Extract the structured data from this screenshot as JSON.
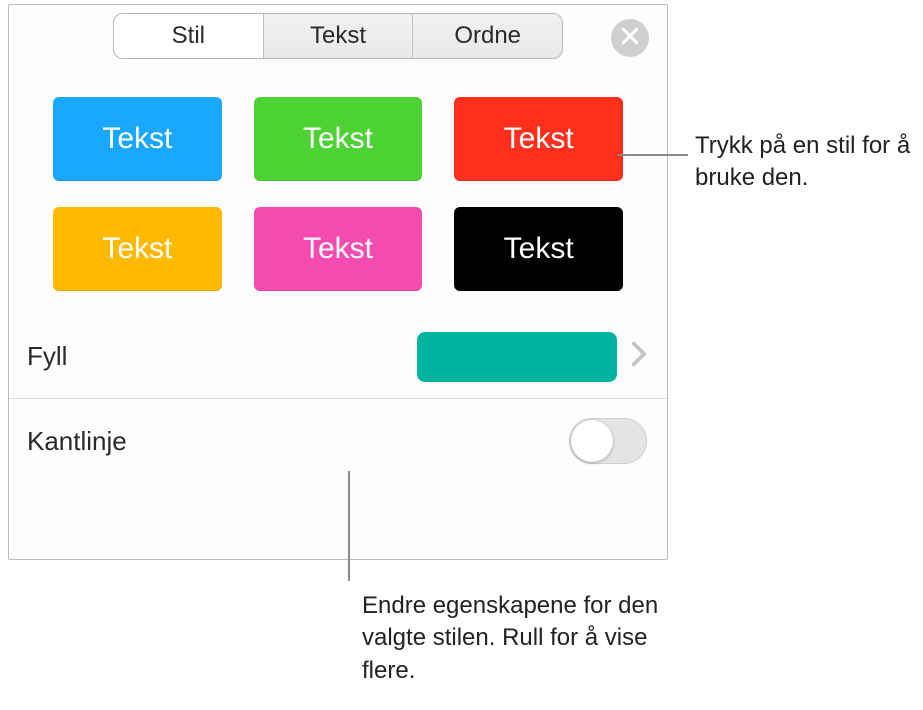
{
  "tabs": {
    "style": "Stil",
    "text": "Tekst",
    "arrange": "Ordne"
  },
  "swatches": [
    {
      "label": "Tekst",
      "bg": "#1aa7ff"
    },
    {
      "label": "Tekst",
      "bg": "#4cd233"
    },
    {
      "label": "Tekst",
      "bg": "#ff2f1e"
    },
    {
      "label": "Tekst",
      "bg": "#ffb901"
    },
    {
      "label": "Tekst",
      "bg": "#f54bb0"
    },
    {
      "label": "Tekst",
      "bg": "#000000"
    }
  ],
  "fill": {
    "label": "Fyll",
    "color": "#00b5a0"
  },
  "border": {
    "label": "Kantlinje"
  },
  "callouts": {
    "tapStyle": "Trykk på en stil for å bruke den.",
    "changeProps": "Endre egenskapene for den valgte stilen. Rull for å vise flere."
  }
}
